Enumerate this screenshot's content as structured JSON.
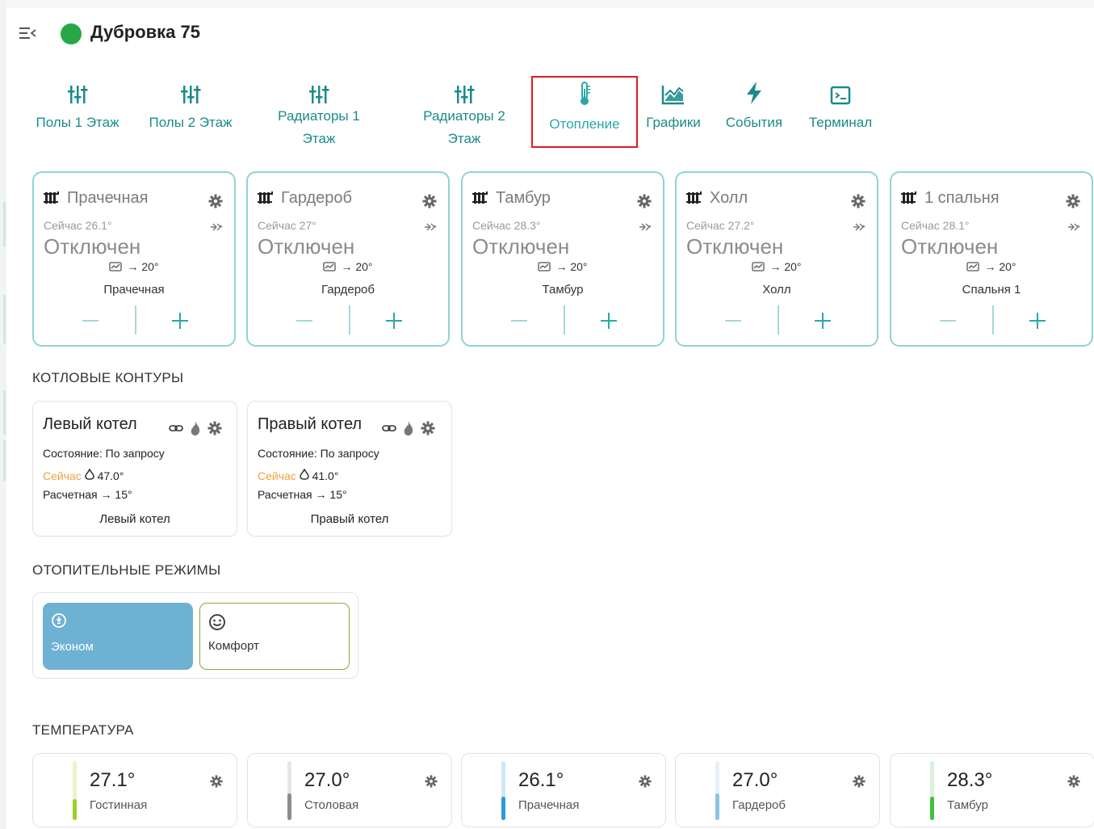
{
  "header": {
    "title": "Дубровка 75",
    "status_color": "#27a844"
  },
  "tabs": [
    {
      "label": "Полы 1 Этаж",
      "icon": "sliders-icon"
    },
    {
      "label": "Полы 2 Этаж",
      "icon": "sliders-icon"
    },
    {
      "label_line1": "Радиаторы 1",
      "label_line2": "Этаж",
      "icon": "sliders-icon"
    },
    {
      "label_line1": "Радиаторы 2",
      "label_line2": "Этаж",
      "icon": "sliders-icon"
    },
    {
      "label": "Отопление",
      "icon": "thermometer-icon",
      "active": true
    },
    {
      "label": "Графики",
      "icon": "chart-icon"
    },
    {
      "label": "События",
      "icon": "lightning-icon"
    },
    {
      "label": "Терминал",
      "icon": "terminal-icon"
    }
  ],
  "rooms": [
    {
      "name": "Прачечная",
      "now": "Сейчас 26.1°",
      "state": "Отключен",
      "target": "→ 20°",
      "sub": "Прачечная"
    },
    {
      "name": "Гардероб",
      "now": "Сейчас 27°",
      "state": "Отключен",
      "target": "→ 20°",
      "sub": "Гардероб"
    },
    {
      "name": "Тамбур",
      "now": "Сейчас 28.3°",
      "state": "Отключен",
      "target": "→ 20°",
      "sub": "Тамбур"
    },
    {
      "name": "Холл",
      "now": "Сейчас 27.2°",
      "state": "Отключен",
      "target": "→ 20°",
      "sub": "Холл"
    },
    {
      "name": "1 спальня",
      "now": "Сейчас 28.1°",
      "state": "Отключен",
      "target": "→ 20°",
      "sub": "Спальня 1"
    }
  ],
  "sections": {
    "boilers": "КОТЛОВЫЕ КОНТУРЫ",
    "modes": "ОТОПИТЕЛЬНЫЕ РЕЖИМЫ",
    "temperature": "ТЕМПЕРАТУРА"
  },
  "boilers": [
    {
      "name": "Левый котел",
      "state": "Состояние: По запросу",
      "now_label": "Сейчас",
      "now_value": "47.0°",
      "calc": "Расчетная → 15°",
      "sub": "Левый котел"
    },
    {
      "name": "Правый котел",
      "state": "Состояние: По запросу",
      "now_label": "Сейчас",
      "now_value": "41.0°",
      "calc": "Расчетная → 15°",
      "sub": "Правый котел"
    }
  ],
  "modes": [
    {
      "label": "Эконом",
      "icon": "bulb-icon",
      "selected": true,
      "color": "#6fb1d2"
    },
    {
      "label": "Комфорт",
      "icon": "smiley-icon",
      "selected": false,
      "color": "#8aa83b"
    }
  ],
  "temperatures": [
    {
      "value": "27.1°",
      "name": "Гостинная",
      "color": "#9bd12b",
      "track": "#e8f5c9",
      "level": 0.35
    },
    {
      "value": "27.0°",
      "name": "Столовая",
      "color": "#8c8c8c",
      "track": "#e6e6e6",
      "level": 0.45
    },
    {
      "value": "26.1°",
      "name": "Прачечная",
      "color": "#2b9bd6",
      "track": "#cfe7f5",
      "level": 0.4
    },
    {
      "value": "27.0°",
      "name": "Гардероб",
      "color": "#8dc3e3",
      "track": "#e3f1f9",
      "level": 0.45
    },
    {
      "value": "28.3°",
      "name": "Тамбур",
      "color": "#3cc23c",
      "track": "#d9f2d9",
      "level": 0.4
    }
  ]
}
